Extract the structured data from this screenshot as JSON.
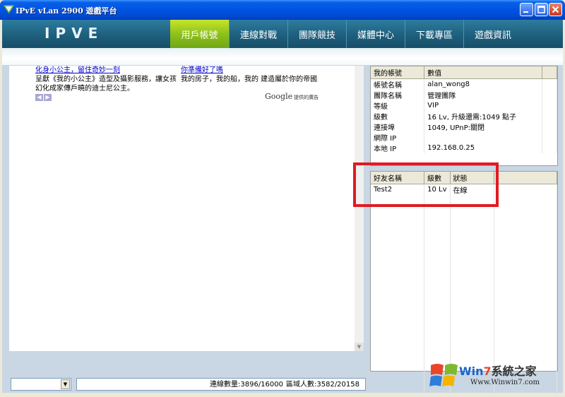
{
  "window": {
    "title": "IPvE vLan 2900 遊戲平台"
  },
  "header": {
    "logo_text": "IPVE",
    "tabs": [
      {
        "label": "用戶帳號",
        "active": true
      },
      {
        "label": "連線對戰",
        "active": false
      },
      {
        "label": "團隊競技",
        "active": false
      },
      {
        "label": "媒體中心",
        "active": false
      },
      {
        "label": "下載專區",
        "active": false
      },
      {
        "label": "遊戲資訊",
        "active": false
      }
    ]
  },
  "ads": [
    {
      "title": "化身小公主，留住奇妙一刻",
      "body": "呈獻《我的小公主》造型及攝影服務，讓女孩幻化成家傳戶曉的迪士尼公主。"
    },
    {
      "title": "你準備好了嗎",
      "body": "我的房子，我的船，我的 建造屬於你的帝國"
    }
  ],
  "ad_footer": {
    "brand": "Google",
    "suffix": "提供的廣告"
  },
  "account": {
    "columns": [
      "我的帳號",
      "數值"
    ],
    "rows": [
      [
        "帳號名稱",
        "alan_wong8"
      ],
      [
        "團隊名稱",
        "管理團隊"
      ],
      [
        "等級",
        "VIP"
      ],
      [
        "級數",
        "16 Lv, 升級還需:1049 點子"
      ],
      [
        "連接埠",
        "1049, UPnP:關閉"
      ],
      [
        "網際 IP",
        ""
      ],
      [
        "本地 IP",
        "192.168.0.25"
      ]
    ]
  },
  "friends": {
    "columns": [
      "好友名稱",
      "級數",
      "狀態"
    ],
    "rows": [
      [
        "Test2",
        "10 Lv",
        "在線"
      ]
    ]
  },
  "status": {
    "online": "連線數量:3896/16000",
    "area": "區域人數:3582/20158"
  },
  "watermark": {
    "text_win": "Win",
    "text_7": "7",
    "text_rest": "系統之家",
    "url": "Www.Winwin7.com"
  },
  "colors": {
    "highlight": "#E11A22",
    "nav_active": "#8EC11A",
    "titlebar": "#0054E3"
  }
}
